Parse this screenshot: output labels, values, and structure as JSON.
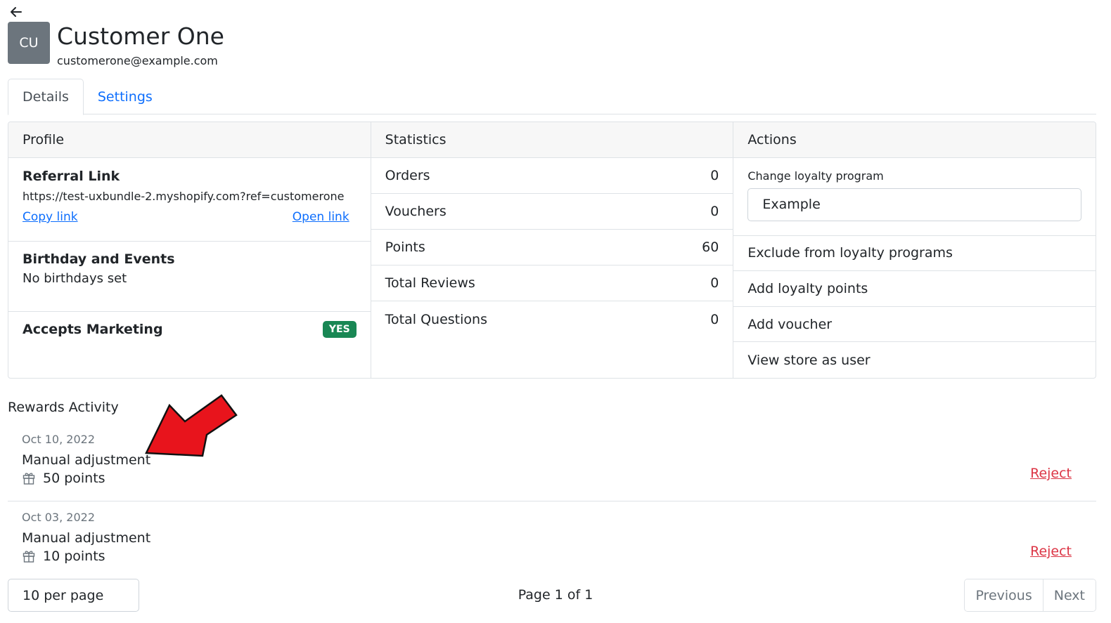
{
  "header": {
    "avatar_initials": "CU",
    "name": "Customer One",
    "email": "customerone@example.com"
  },
  "tabs": [
    {
      "label": "Details",
      "active": true
    },
    {
      "label": "Settings",
      "active": false
    }
  ],
  "profile": {
    "title": "Profile",
    "referral_title": "Referral Link",
    "referral_url": "https://test-uxbundle-2.myshopify.com?ref=customerone",
    "copy_link": "Copy link",
    "open_link": "Open link",
    "birthday_title": "Birthday and Events",
    "birthday_text": "No birthdays set",
    "marketing_title": "Accepts Marketing",
    "marketing_badge": "YES"
  },
  "statistics": {
    "title": "Statistics",
    "rows": [
      {
        "label": "Orders",
        "value": "0"
      },
      {
        "label": "Vouchers",
        "value": "0"
      },
      {
        "label": "Points",
        "value": "60"
      },
      {
        "label": "Total Reviews",
        "value": "0"
      },
      {
        "label": "Total Questions",
        "value": "0"
      }
    ]
  },
  "actions": {
    "title": "Actions",
    "loyalty_label": "Change loyalty program",
    "loyalty_value": "Example",
    "items": [
      "Exclude from loyalty programs",
      "Add loyalty points",
      "Add voucher",
      "View store as user"
    ]
  },
  "activity": {
    "title": "Rewards Activity",
    "items": [
      {
        "date": "Oct 10, 2022",
        "description": "Manual adjustment",
        "points": "50 points",
        "action": "Reject"
      },
      {
        "date": "Oct 03, 2022",
        "description": "Manual adjustment",
        "points": "10 points",
        "action": "Reject"
      }
    ]
  },
  "pagination": {
    "per_page": "10 per page",
    "page_info": "Page 1 of 1",
    "previous": "Previous",
    "next": "Next"
  },
  "colors": {
    "link": "#0d6efd",
    "danger": "#dc3545",
    "success": "#198754",
    "avatar_bg": "#6c757d",
    "annotation": "#e8141c"
  },
  "icons": {
    "back": "arrow-left-icon",
    "gift": "gift-icon",
    "annotation": "red-arrow-annotation"
  }
}
